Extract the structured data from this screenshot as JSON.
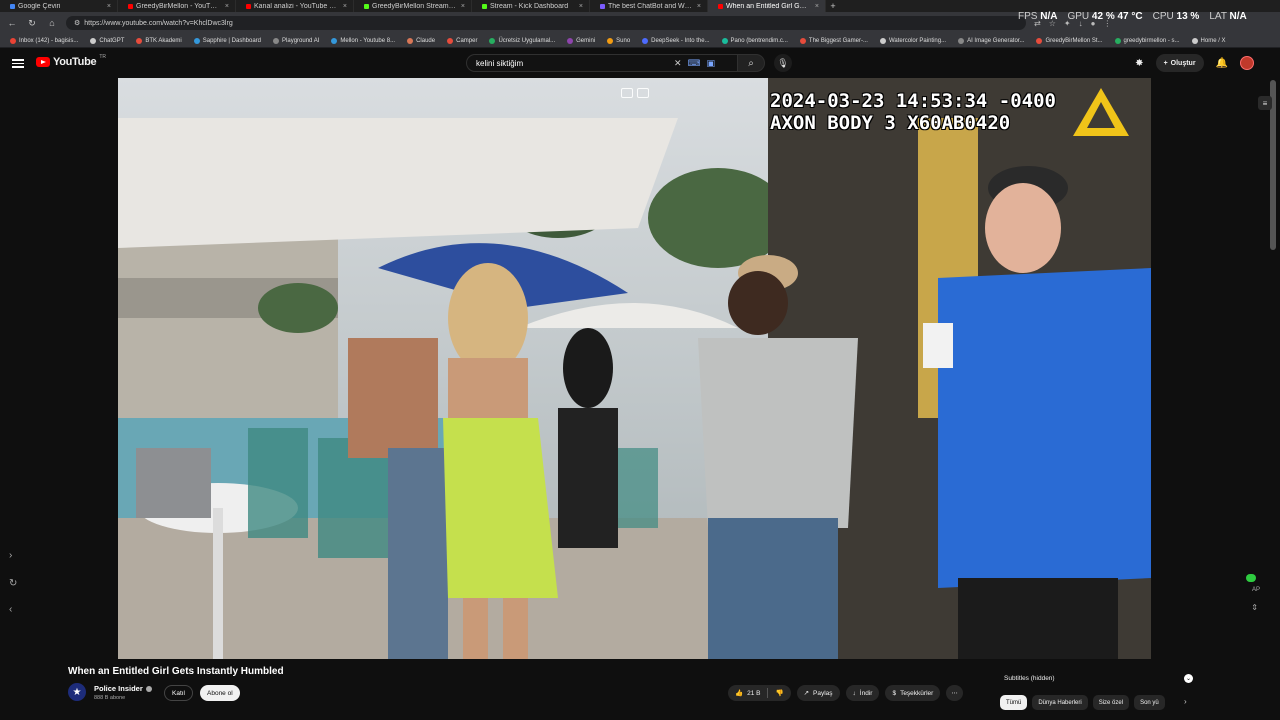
{
  "tabs": [
    {
      "label": "Google Çeviri",
      "color": "#4285f4"
    },
    {
      "label": "GreedyBirMellon - YouTube",
      "color": "#ff0000"
    },
    {
      "label": "Kanal analizi - YouTube Studio",
      "color": "#ff0000"
    },
    {
      "label": "GreedyBirMellon Stream - Watch",
      "color": "#53fc18"
    },
    {
      "label": "Stream - Kick Dashboard",
      "color": "#53fc18"
    },
    {
      "label": "The best ChatBot and Widgets fo",
      "color": "#7b5cff"
    },
    {
      "label": "When an Entitled Girl Gets I",
      "color": "#ff0000",
      "active": true
    }
  ],
  "hud": {
    "fps_label": "FPS",
    "fps_value": "N/A",
    "gpu_label": "GPU",
    "gpu_value": "42 % 47 °C",
    "cpu_label": "CPU",
    "cpu_value": "13 %",
    "lat_label": "LAT",
    "lat_value": "N/A"
  },
  "address": {
    "url": "https://www.youtube.com/watch?v=KhclDwc3lrg"
  },
  "bookmarks": [
    {
      "label": "Inbox (142) - bagisis...",
      "color": "#ea4335"
    },
    {
      "label": "ChatGPT",
      "color": "#cccccc"
    },
    {
      "label": "BTK Akademi",
      "color": "#e74c3c"
    },
    {
      "label": "Sapphire | Dashboard",
      "color": "#3498db"
    },
    {
      "label": "Playground AI",
      "color": "#888888"
    },
    {
      "label": "Mellon - Youtube 8...",
      "color": "#3498db"
    },
    {
      "label": "Claude",
      "color": "#d97757"
    },
    {
      "label": "Camper",
      "color": "#e74c3c"
    },
    {
      "label": "Ücretsiz Uygulamal...",
      "color": "#27ae60"
    },
    {
      "label": "Gemini",
      "color": "#8e44ad"
    },
    {
      "label": "Suno",
      "color": "#f39c12"
    },
    {
      "label": "DeepSeek - Into the...",
      "color": "#4d6bfe"
    },
    {
      "label": "Pano (bentrendim.c...",
      "color": "#1abc9c"
    },
    {
      "label": "The Biggest Gamer-...",
      "color": "#e74c3c"
    },
    {
      "label": "Watercolor Painting...",
      "color": "#cccccc"
    },
    {
      "label": "AI Image Generator...",
      "color": "#888888"
    },
    {
      "label": "GreedyBirMellon St...",
      "color": "#e74c3c"
    },
    {
      "label": "greedybirmellon - s...",
      "color": "#27ae60"
    },
    {
      "label": "Home / X",
      "color": "#cccccc"
    }
  ],
  "youtube": {
    "logo_text": "YouTube",
    "country_code": "TR",
    "search_value": "kelini siktiğim",
    "create_label": "Oluştur"
  },
  "video": {
    "timestamp_line1": "2024-03-23 14:53:34 -0400",
    "timestamp_line2": "AXON BODY 3 X60AB0420"
  },
  "info": {
    "title": "When an Entitled Girl Gets Instantly Humbled",
    "channel": "Police Insider",
    "subscribers": "888 B abone",
    "join_label": "Katıl",
    "subscribe_label": "Abone ol",
    "likes": "21 B",
    "share_label": "Paylaş",
    "download_label": "İndir",
    "thanks_label": "Teşekkürler",
    "subtitles_label": "Subtitles (hidden)",
    "ap_label": "AP"
  },
  "chips": [
    {
      "label": "Tümü",
      "active": true
    },
    {
      "label": "Dünya Haberleri"
    },
    {
      "label": "Size özel"
    },
    {
      "label": "Son yü"
    }
  ]
}
